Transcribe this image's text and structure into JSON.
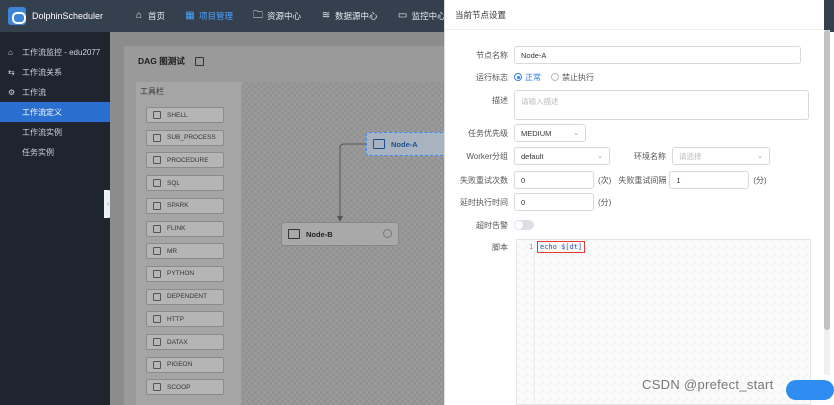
{
  "app": {
    "name": "DolphinScheduler"
  },
  "nav": [
    {
      "icon": "home-icon",
      "glyph": "⌂",
      "label": "首页",
      "active": false
    },
    {
      "icon": "project-icon",
      "glyph": "▦",
      "label": "项目管理",
      "active": true
    },
    {
      "icon": "folder-icon",
      "glyph": "🗀",
      "label": "资源中心",
      "active": false
    },
    {
      "icon": "database-icon",
      "glyph": "≋",
      "label": "数据源中心",
      "active": false
    },
    {
      "icon": "monitor-icon",
      "glyph": "▭",
      "label": "监控中心",
      "active": false
    }
  ],
  "sidebar": {
    "items": [
      {
        "icon": "home-icon",
        "glyph": "⌂",
        "label": "工作流监控 - edu2077"
      },
      {
        "icon": "relation-icon",
        "glyph": "⇆",
        "label": "工作流关系"
      },
      {
        "icon": "gear-icon",
        "glyph": "⚙",
        "label": "工作流"
      }
    ],
    "sub": [
      {
        "label": "工作流定义",
        "active": true
      },
      {
        "label": "工作流实例",
        "active": false
      },
      {
        "label": "任务实例",
        "active": false
      }
    ]
  },
  "dag": {
    "title": "DAG 图测试",
    "toolbox_title": "工具栏",
    "tools": [
      "SHELL",
      "SUB_PROCESS",
      "PROCEDURE",
      "SQL",
      "SPARK",
      "FLINK",
      "MR",
      "PYTHON",
      "DEPENDENT",
      "HTTP",
      "DATAX",
      "PIGEON",
      "SCOOP"
    ],
    "nodes": [
      {
        "label": "Node-A",
        "selected": true
      },
      {
        "label": "Node-B",
        "selected": false
      }
    ]
  },
  "drawer": {
    "title": "当前节点设置",
    "node_name_label": "节点名称",
    "node_name_value": "Node-A",
    "run_flag_label": "运行标志",
    "run_flag_options": [
      "正常",
      "禁止执行"
    ],
    "desc_label": "描述",
    "desc_placeholder": "请输入描述",
    "priority_label": "任务优先级",
    "priority_value": "MEDIUM",
    "worker_label": "Worker分组",
    "worker_value": "default",
    "env_label": "环境名称",
    "env_placeholder": "请选择",
    "retry_times_label": "失败重试次数",
    "retry_times_value": "0",
    "retry_times_unit": "(次)",
    "retry_interval_label": "失败重试间隔",
    "retry_interval_value": "1",
    "retry_interval_unit": "(分)",
    "delay_label": "延时执行时间",
    "delay_value": "0",
    "delay_unit": "(分)",
    "timeout_label": "超时告警",
    "script_label": "脚本",
    "script_line_no": "1",
    "script_code": "echo $[dt]"
  },
  "watermark": "CSDN @prefect_start"
}
